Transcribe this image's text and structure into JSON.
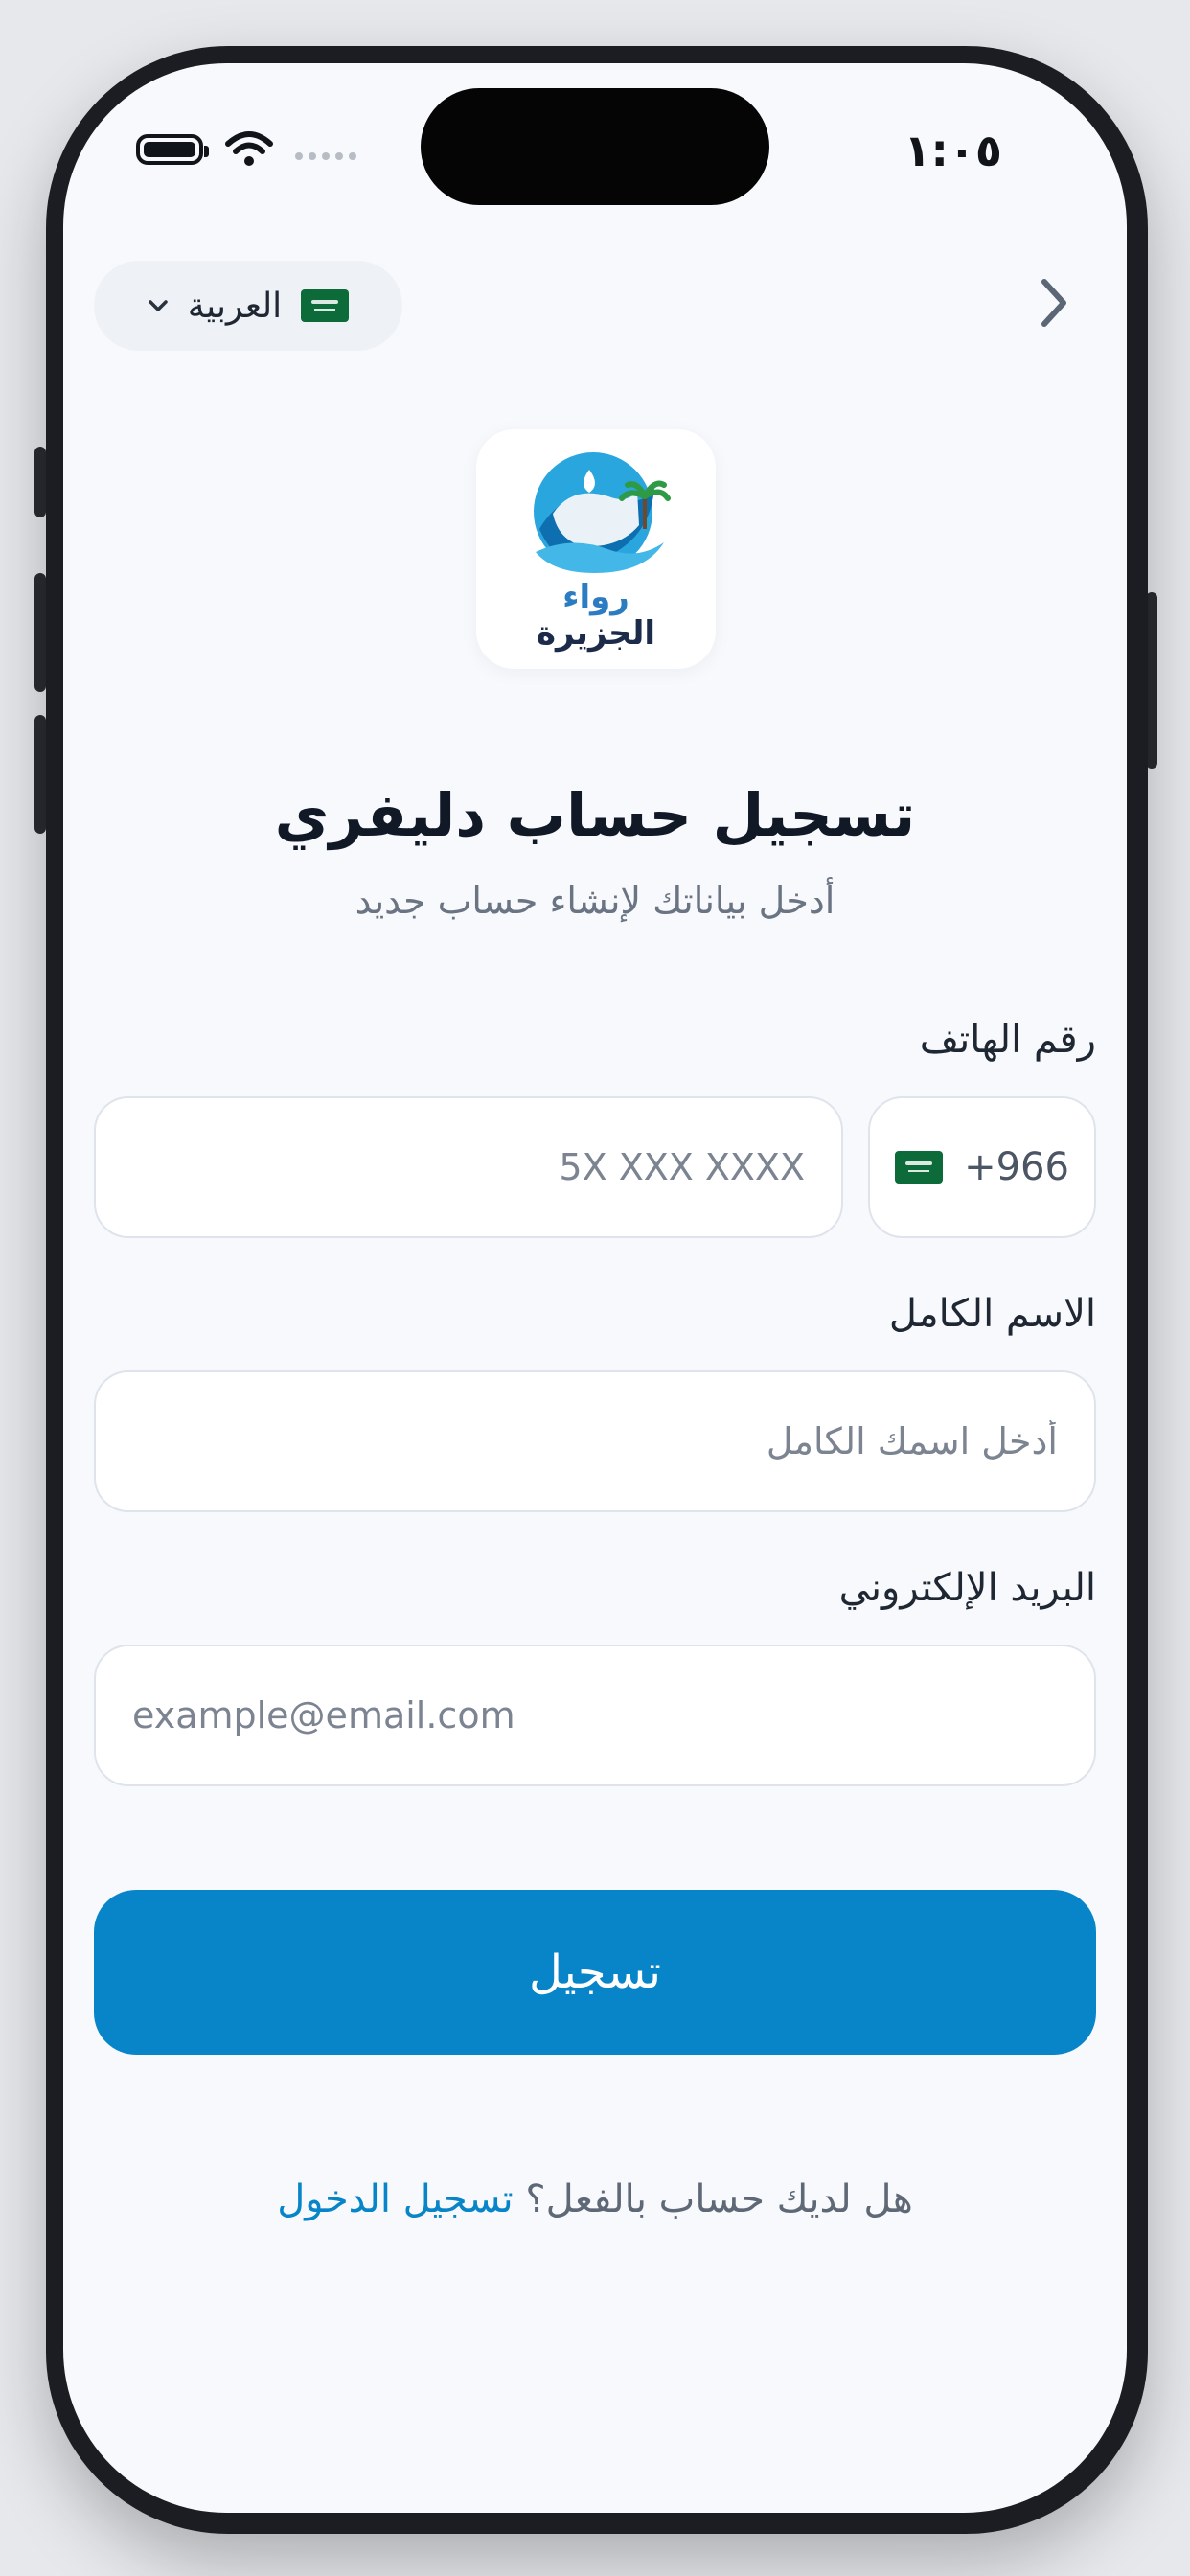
{
  "status_bar": {
    "time": "١:٠٥"
  },
  "header": {
    "language_label": "العربية",
    "language_flag_icon": "saudi-flag-icon",
    "language_chevron_icon": "chevron-down-icon",
    "back_icon": "chevron-right-icon"
  },
  "logo": {
    "line1": "رواء",
    "line2": "الجزيرة"
  },
  "page": {
    "title": "تسجيل حساب دليفري",
    "subtitle": "أدخل بياناتك لإنشاء حساب جديد"
  },
  "form": {
    "phone": {
      "label": "رقم الهاتف",
      "country_code": "+966",
      "value": "",
      "placeholder": "5X XXX XXXX"
    },
    "full_name": {
      "label": "الاسم الكامل",
      "value": "",
      "placeholder": "أدخل اسمك الكامل"
    },
    "email": {
      "label": "البريد الإلكتروني",
      "value": "",
      "placeholder": "example@email.com"
    },
    "submit_label": "تسجيل"
  },
  "footer": {
    "question": "هل لديك حساب بالفعل؟",
    "login_link": "تسجيل الدخول"
  },
  "colors": {
    "primary": "#0785c8",
    "background": "#f7f9fc",
    "logo_blue": "#2b7cc0",
    "logo_navy": "#1c2b4a",
    "flag_green": "#0d6b3a"
  }
}
